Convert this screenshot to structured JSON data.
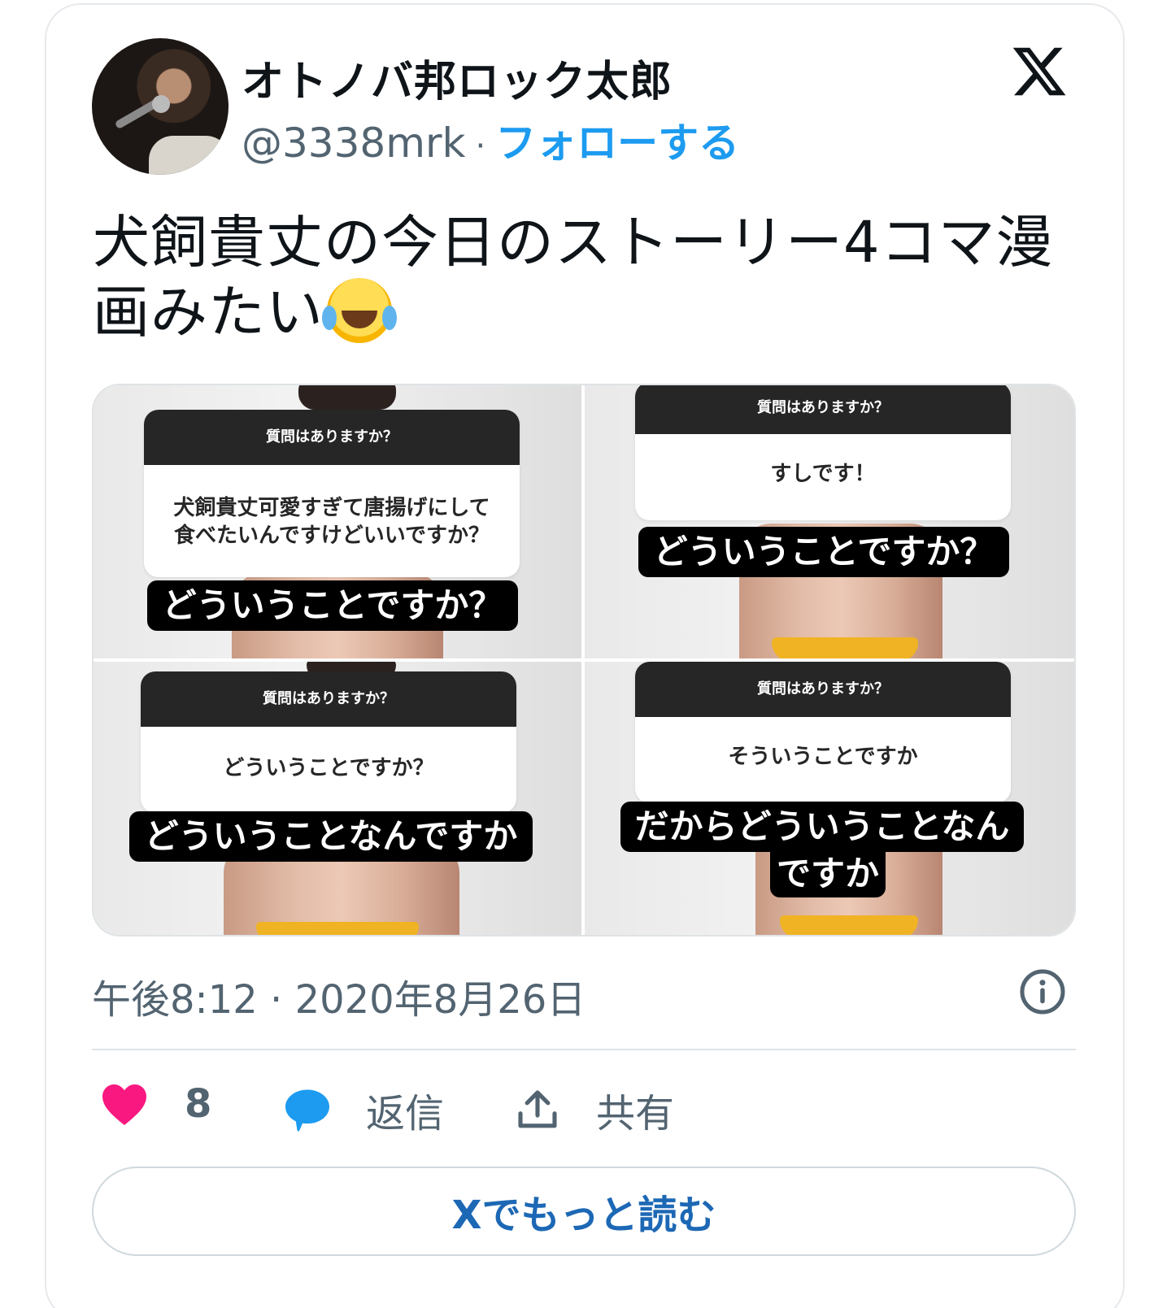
{
  "author": {
    "display_name": "オトノバ邦ロック太郎",
    "handle": "@3338mrk",
    "separator": "·",
    "follow_label": "フォローする",
    "avatar": "avatar-photo"
  },
  "platform_logo": "x-logo",
  "tweet": {
    "text_line1": "犬飼貴丈の今日のストーリー4コマ漫",
    "text_line2": "画みたい",
    "emoji": "face-with-tears-of-joy"
  },
  "media": {
    "panels": [
      {
        "question_header": "質問はありますか？",
        "question_lines": [
          "犬飼貴丈可愛すぎて唐揚げにして",
          "食べたいんですけどいいですか？"
        ],
        "caption_lines": [
          "どういうことですか？"
        ]
      },
      {
        "question_header": "質問はありますか？",
        "question_lines": [
          "すしです！"
        ],
        "caption_lines": [
          "どういうことですか？"
        ]
      },
      {
        "question_header": "質問はありますか？",
        "question_lines": [
          "どういうことですか？"
        ],
        "caption_lines": [
          "どういうことなんですか"
        ]
      },
      {
        "question_header": "質問はありますか？",
        "question_lines": [
          "そういうことですか"
        ],
        "caption_lines": [
          "だからどういうことなん",
          "ですか"
        ]
      }
    ]
  },
  "timestamp": "午後8:12 · 2020年8月26日",
  "actions": {
    "like_count": "8",
    "reply_label": "返信",
    "share_label": "共有"
  },
  "read_more_label": "Xでもっと読む",
  "colors": {
    "accent": "#1d9bf0",
    "like": "#f91880",
    "reply": "#1d9bf0",
    "muted": "#536471"
  }
}
